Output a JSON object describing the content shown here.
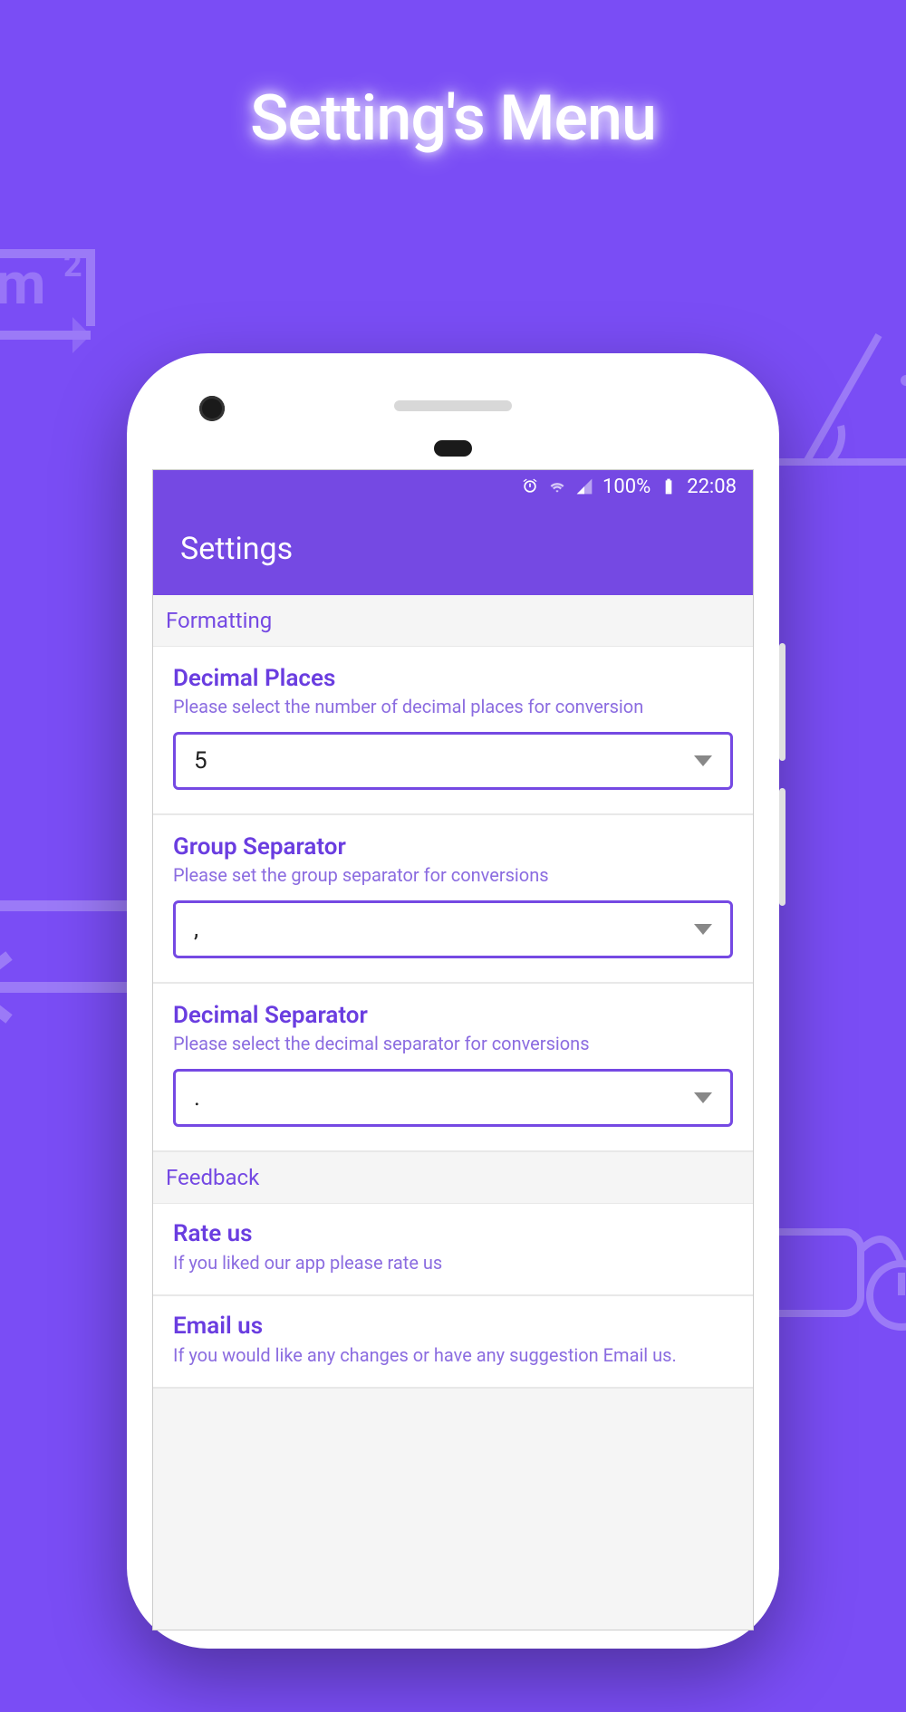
{
  "promo": {
    "title": "Setting's Menu"
  },
  "statusbar": {
    "battery": "100%",
    "time": "22:08"
  },
  "toolbar": {
    "title": "Settings"
  },
  "sections": {
    "formatting": {
      "header": "Formatting",
      "decimal_places": {
        "title": "Decimal Places",
        "sub": "Please select the number of decimal places for conversion",
        "value": "5"
      },
      "group_separator": {
        "title": "Group Separator",
        "sub": "Please set the group separator for conversions",
        "value": ","
      },
      "decimal_separator": {
        "title": "Decimal Separator",
        "sub": "Please select the decimal separator for conversions",
        "value": "."
      }
    },
    "feedback": {
      "header": "Feedback",
      "rate": {
        "title": "Rate us",
        "sub": "If you liked our app please rate us"
      },
      "email": {
        "title": "Email us",
        "sub": "If you would like any changes or have any suggestion Email us."
      }
    }
  }
}
